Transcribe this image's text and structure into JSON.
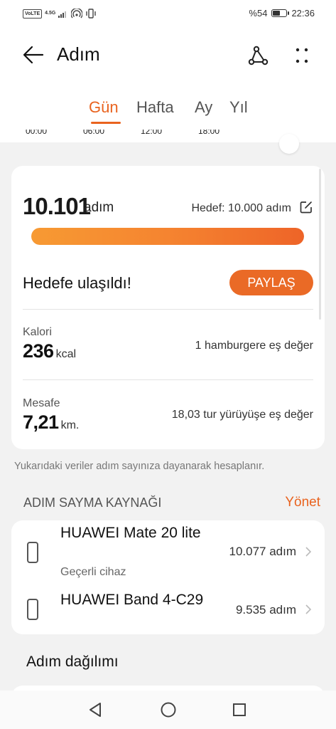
{
  "status_bar": {
    "volte": "VoLTE",
    "network": "4.5G",
    "battery_text": "%54",
    "time": "22:36"
  },
  "app_bar": {
    "title": "Adım",
    "icons": [
      "back-arrow-icon",
      "route-icon",
      "more-icon"
    ]
  },
  "tabs": [
    {
      "label": "Gün",
      "active": true
    },
    {
      "label": "Hafta",
      "active": false
    },
    {
      "label": "Ay",
      "active": false
    },
    {
      "label": "Yıl",
      "active": false
    }
  ],
  "time_axis": [
    "00:00",
    "06:00",
    "12:00",
    "18:00"
  ],
  "summary": {
    "steps": "10.101",
    "steps_unit": "adım",
    "goal": "Hedef: 10.000 adım",
    "progress_fraction": 1.0,
    "goal_reached": "Hedefe ulaşıldı!",
    "share_label": "PAYLAŞ"
  },
  "metrics": [
    {
      "label": "Kalori",
      "value": "236",
      "unit": "kcal",
      "equivalent": "1 hamburgere eş değer"
    },
    {
      "label": "Mesafe",
      "value": "7,21",
      "unit": "km.",
      "equivalent": "18,03 tur yürüyüşe eş değer"
    }
  ],
  "footnote": "Yukarıdaki veriler adım sayınıza dayanarak hesaplanır.",
  "sources": {
    "heading": "ADIM SAYMA KAYNAĞI",
    "manage_label": "Yönet",
    "devices": [
      {
        "name": "HUAWEI Mate 20 lite",
        "subtitle": "Geçerli cihaz",
        "steps": "10.077 adım"
      },
      {
        "name": "HUAWEI Band 4-C29",
        "subtitle": "",
        "steps": "9.535 adım"
      }
    ]
  },
  "distribution_title": "Adım dağılımı",
  "colors": {
    "accent": "#e9631f",
    "progress_start": "#f79a33",
    "progress_end": "#ee6428"
  },
  "nav_bar": [
    "back-triangle-icon",
    "home-circle-icon",
    "recents-square-icon"
  ]
}
